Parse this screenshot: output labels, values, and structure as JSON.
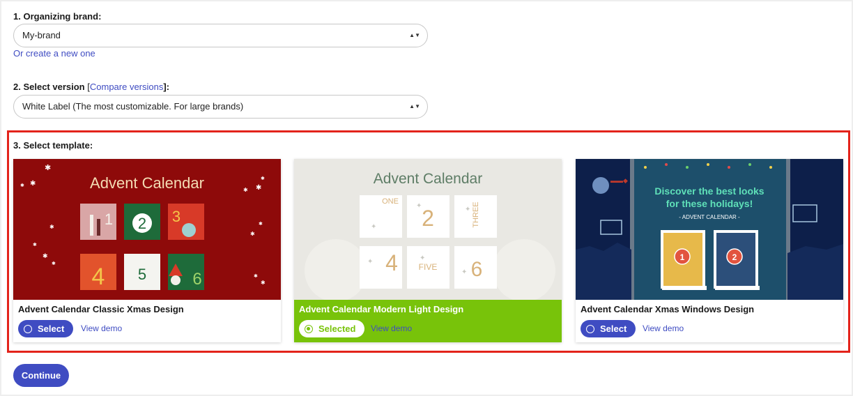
{
  "brand_field": {
    "label": "1. Organizing brand:",
    "value": "My-brand",
    "create_link": "Or create a new one"
  },
  "version_field": {
    "label": "2. Select version",
    "bracket_open": "[",
    "compare_link": "Compare versions",
    "bracket_close": "]:",
    "value": "White Label (The most customizable. For large brands)"
  },
  "template_field": {
    "label": "3. Select template:",
    "templates": [
      {
        "title": "Advent Calendar Classic Xmas Design",
        "button": "Select",
        "demo": "View demo",
        "selected": false,
        "thumb_title": "Advent Calendar",
        "thumb_numbers": [
          "1",
          "2",
          "3",
          "4",
          "5",
          "6"
        ]
      },
      {
        "title": "Advent Calendar Modern Light Design",
        "button": "Selected",
        "demo": "View demo",
        "selected": true,
        "thumb_title": "Advent Calendar",
        "thumb_numbers": [
          "ONE",
          "2",
          "THREE",
          "4",
          "FIVE",
          "6"
        ]
      },
      {
        "title": "Advent Calendar Xmas Windows Design",
        "button": "Select",
        "demo": "View demo",
        "selected": false,
        "thumb_headline_1": "Discover the best looks",
        "thumb_headline_2": "for these holidays!",
        "thumb_sub": "- ADVENT CALENDAR -",
        "thumb_numbers": [
          "1",
          "2"
        ]
      }
    ]
  },
  "continue_label": "Continue",
  "colors": {
    "accent": "#3f4cc2",
    "selected_green": "#78c30a",
    "highlight_red": "#e3231b"
  }
}
